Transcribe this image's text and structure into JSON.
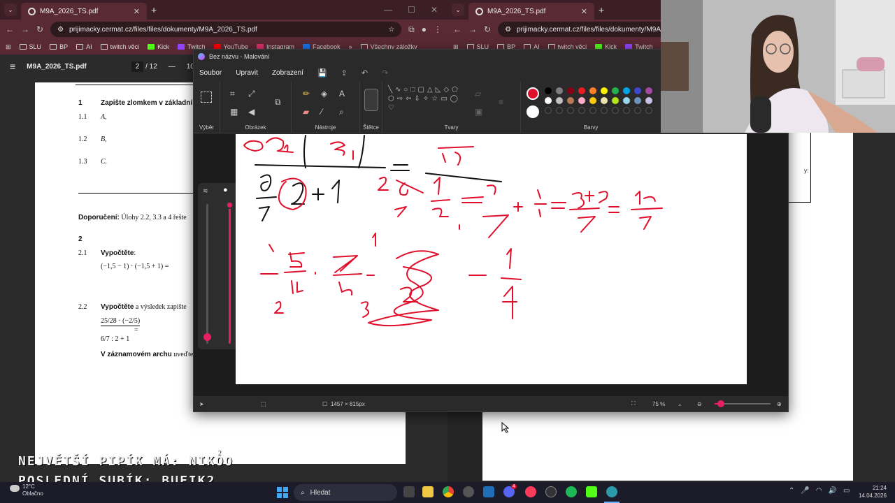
{
  "browser_left": {
    "tab_title": "M9A_2026_TS.pdf",
    "url": "prijimacky.cermat.cz/files/files/dokumenty/M9A_2026_TS.pdf",
    "bookmarks": [
      "SLU",
      "BP",
      "AI",
      "twitch věci",
      "Kick",
      "Twitch",
      "YouTube",
      "Instagram",
      "Facebook"
    ],
    "more_bookmarks": "»",
    "all_bookmarks": "Všechny záložky",
    "pdf_name": "M9A_2026_TS.pdf",
    "page_current": "2",
    "page_sep": "/ 12",
    "zoom_hint": "10"
  },
  "browser_right": {
    "tab_title": "M9A_2026_TS.pdf",
    "url": "prijimacky.cermat.cz/files/files/dokumenty/M9A_",
    "bookmarks": [
      "SLU",
      "BP",
      "AI",
      "twitch věci",
      "Kick",
      "Twitch"
    ]
  },
  "pdf": {
    "q1_num": "1",
    "q1_text": "Zapište zlomkem v základní",
    "q1_1": "1.1",
    "q1_1_val": "A,",
    "q1_2": "1.2",
    "q1_2_val": "B,",
    "q1_3": "1.3",
    "q1_3_val": "C.",
    "recommend_label": "Doporučení:",
    "recommend_text": "Úlohy 2.2, 3.3 a 4 řešte",
    "q2_num": "2",
    "q2_1": "2.1",
    "q2_1_verb": "Vypočtěte",
    "q2_1_expr": "(−1,5 − 1) · (−1,5 + 1) =",
    "q2_2": "2.2",
    "q2_2_verb": "Vypočtěte",
    "q2_2_rest": "a výsledek zapište",
    "q2_2_expr_top": "25/28 · (−2/5)",
    "q2_2_expr_bot": "6/7 : 2 + 1",
    "q2_2_eq": "=",
    "answer_sheet_bold": "V záznamovém archu",
    "answer_sheet_rest": "uveďte",
    "page_number": "2"
  },
  "paint": {
    "title": "Bez názvu - Malování",
    "menu": [
      "Soubor",
      "Upravit",
      "Zobrazení"
    ],
    "groups": [
      "Výběr",
      "Obrázek",
      "Nástroje",
      "Štětce",
      "Tvary",
      "Barvy"
    ],
    "canvas_size": "1457 × 815px",
    "zoom": "75 %",
    "primary_color": "#e0102c",
    "secondary_color": "#ffffff",
    "palette": [
      "#000000",
      "#7f7f7f",
      "#880015",
      "#ed1c24",
      "#ff7f27",
      "#fff200",
      "#22b14c",
      "#00a2e8",
      "#3f48cc",
      "#a349a4",
      "#ffffff",
      "#c3c3c3",
      "#b97a57",
      "#ffaec9",
      "#ffc90e",
      "#efe4b0",
      "#b5e61d",
      "#99d9ea",
      "#7092be",
      "#c8bfe7"
    ]
  },
  "overlay": {
    "line1": "NEJVĚTŠÍ PIPÍK MÁ: NIKOO",
    "line2": "POSLEDNÍ SUBÍK: BUFIK2"
  },
  "taskbar": {
    "temp": "12°C",
    "weather": "Oblačno",
    "search": "Hledat",
    "time": "21:24",
    "date": "14.04.2026",
    "badge": "4"
  }
}
